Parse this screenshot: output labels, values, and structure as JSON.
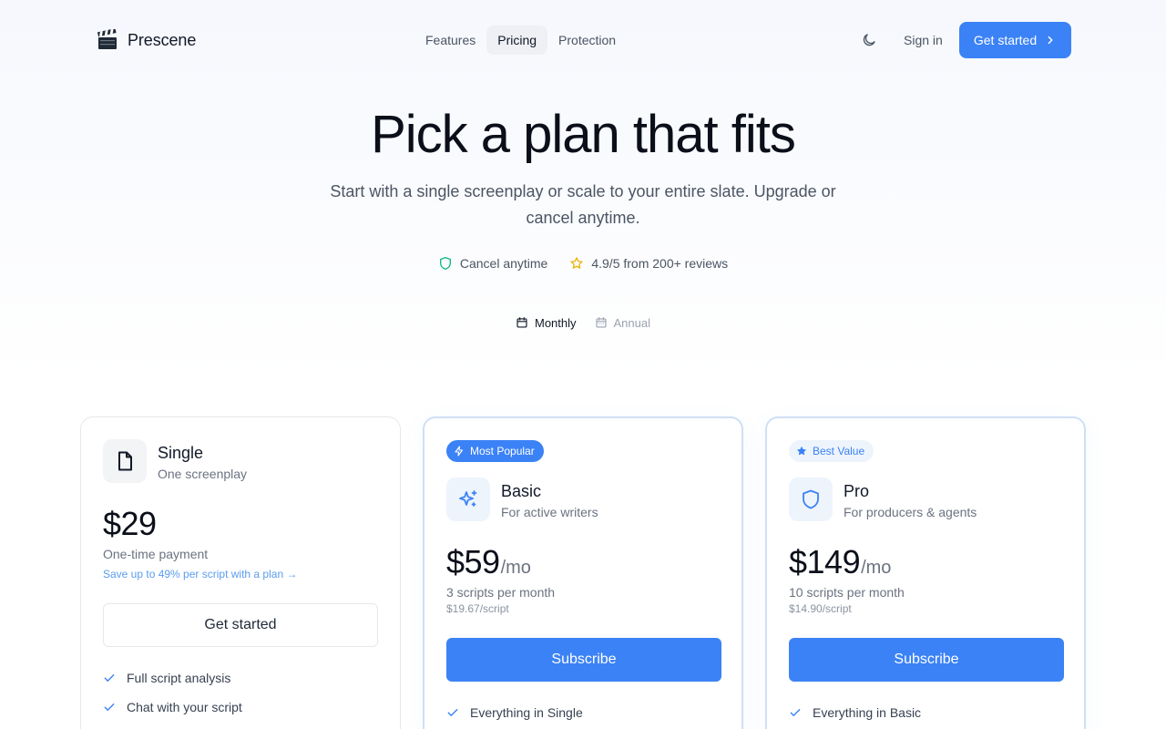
{
  "header": {
    "brand": "Prescene",
    "nav": [
      {
        "label": "Features",
        "active": false
      },
      {
        "label": "Pricing",
        "active": true
      },
      {
        "label": "Protection",
        "active": false
      }
    ],
    "theme_icon": "moon-icon",
    "signin_label": "Sign in",
    "cta_label": "Get started"
  },
  "hero": {
    "title": "Pick a plan that fits",
    "subtitle": "Start with a single screenplay or scale to your entire slate. Upgrade or cancel anytime.",
    "trust": [
      {
        "icon": "shield-icon",
        "label": "Cancel anytime",
        "color": "#10b981"
      },
      {
        "icon": "star-icon",
        "label": "4.9/5 from 200+ reviews",
        "color": "#eab308"
      }
    ]
  },
  "billing": {
    "options": [
      {
        "label": "Monthly",
        "selected": true
      },
      {
        "label": "Annual",
        "selected": false
      }
    ]
  },
  "plans": [
    {
      "name": "Single",
      "description": "One screenplay",
      "icon": "document-icon",
      "price": "$29",
      "period": "",
      "price_note": "One-time payment",
      "upsell": "Save up to 49% per script with a plan →",
      "cta": "Get started",
      "features": [
        "Full script analysis",
        "Chat with your script"
      ]
    },
    {
      "badge": "Most Popular",
      "name": "Basic",
      "description": "For active writers",
      "icon": "sparkles-icon",
      "price": "$59",
      "period": "/mo",
      "price_note": "3 scripts per month",
      "price_sub": "$19.67/script",
      "cta": "Subscribe",
      "features": [
        "Everything in Single"
      ]
    },
    {
      "badge": "Best Value",
      "name": "Pro",
      "description": "For producers & agents",
      "icon": "shield-icon",
      "price": "$149",
      "period": "/mo",
      "price_note": "10 scripts per month",
      "price_sub": "$14.90/script",
      "cta": "Subscribe",
      "features": [
        "Everything in Basic"
      ]
    }
  ],
  "colors": {
    "accent": "#3b82f6",
    "check": "#3b82f6"
  }
}
